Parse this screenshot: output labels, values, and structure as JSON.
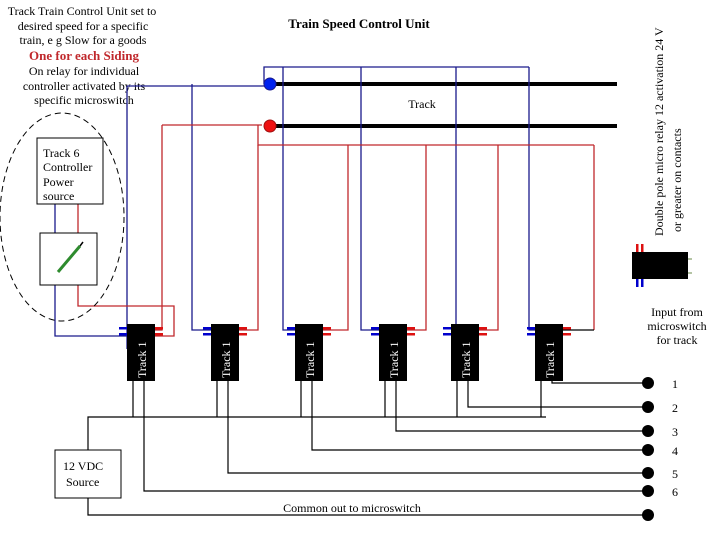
{
  "title": "Train Speed Control Unit",
  "intro_lines": [
    "Track Train Control Unit set to",
    "desired speed for a specific",
    "train, e g Slow for a goods"
  ],
  "highlight": "One for each Siding",
  "relay_note_lines": [
    "On relay for individual",
    "controller activated by its",
    "specific microswitch"
  ],
  "track_label": "Track",
  "controller_lines": [
    "Track 6",
    "Controller",
    "Power",
    "source"
  ],
  "relay_spec_lines": [
    "Double pole micro relay 12 activation 24 V",
    "or greater on contacts"
  ],
  "input_lines": [
    "Input from",
    "microswitch",
    "for track"
  ],
  "relays": [
    "Track 1",
    "Track 1",
    "Track 1",
    "Track 1",
    "Track 1",
    "Track 1"
  ],
  "terminals": [
    "1",
    "2",
    "3",
    "4",
    "5",
    "6"
  ],
  "power_lines": [
    "12 VDC",
    "Source"
  ],
  "common_label": "Common out to microswitch",
  "colors": {
    "blue_wire": "#1a1a8c",
    "red_wire": "#c0282c",
    "highlight": "#c0282c",
    "blue_pin": "#0000cc",
    "red_pin": "#dd1111",
    "meter_needle": "#2e8b2e"
  }
}
